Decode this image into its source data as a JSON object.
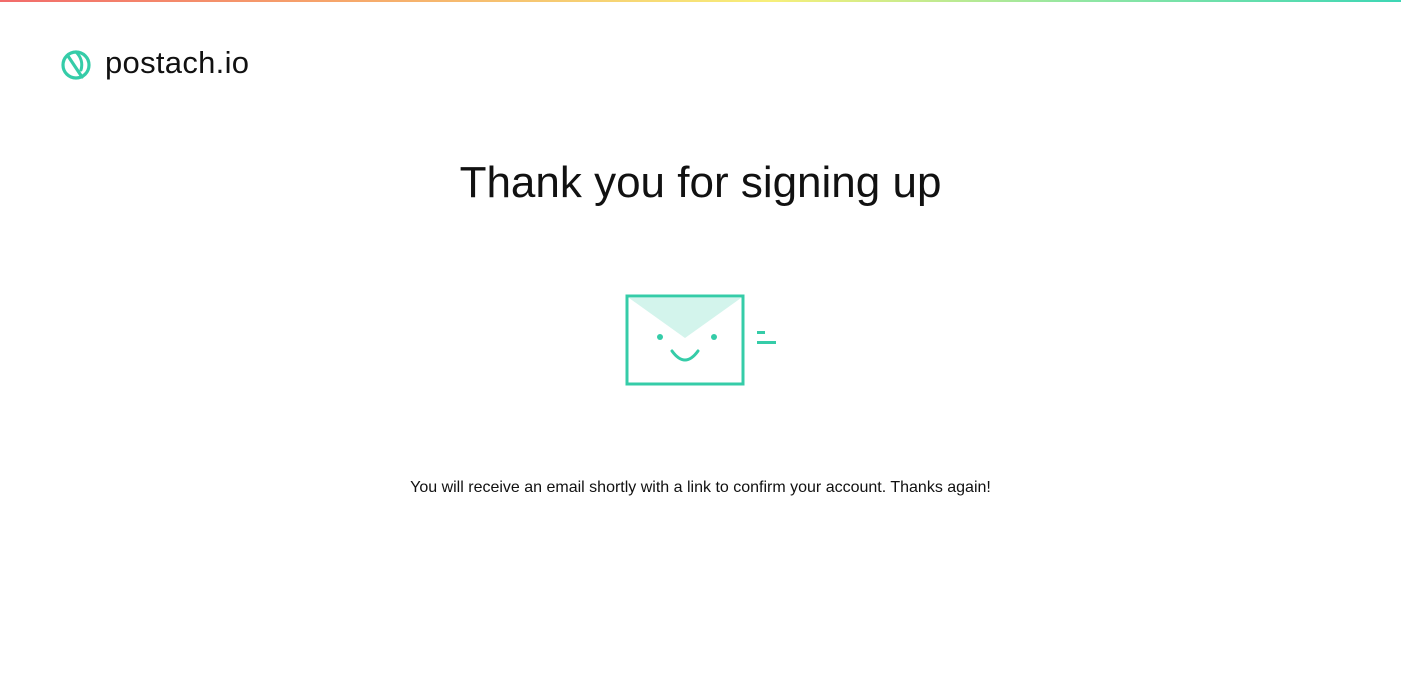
{
  "brand": {
    "name": "postach.io",
    "logo_icon": "leaf-circle-icon",
    "accent_color": "#35cca8",
    "accent_light": "#d3f4ec"
  },
  "top_bar": {
    "gradient_colors": [
      "#f26b6b",
      "#f6a86b",
      "#f7ef7a",
      "#8ee6a4",
      "#3dd6b5"
    ]
  },
  "main": {
    "title": "Thank you for signing up",
    "illustration": "smiling-envelope-icon",
    "message": "You will receive an email shortly with a link to confirm your account. Thanks again!"
  }
}
